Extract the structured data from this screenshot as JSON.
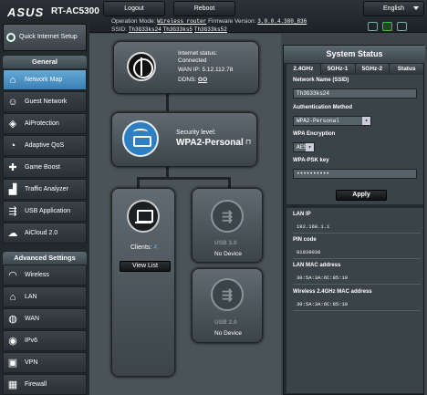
{
  "header": {
    "brand": "ASUS",
    "model": "RT-AC5300",
    "logout_label": "Logout",
    "reboot_label": "Reboot",
    "language": "English",
    "operation_mode_label": "Operation Mode:",
    "operation_mode_value": "Wireless router",
    "firmware_label": "Firmware Version:",
    "firmware_value": "3.0.0.4.380_836",
    "ssid_label": "SSID:",
    "ssids": [
      "Th3G33ks24",
      "Th3G33ks5",
      "Th3G33ks52"
    ]
  },
  "sidebar": {
    "quick_setup": "Quick Internet Setup",
    "general_heading": "General",
    "general_items": [
      {
        "label": "Network Map",
        "icon": "network-map-icon"
      },
      {
        "label": "Guest Network",
        "icon": "guest-network-icon"
      },
      {
        "label": "AiProtection",
        "icon": "shield-icon"
      },
      {
        "label": "Adaptive QoS",
        "icon": "gauge-icon"
      },
      {
        "label": "Game Boost",
        "icon": "gamepad-icon"
      },
      {
        "label": "Traffic Analyzer",
        "icon": "chart-icon"
      },
      {
        "label": "USB Application",
        "icon": "usb-icon"
      },
      {
        "label": "AiCloud 2.0",
        "icon": "cloud-icon"
      }
    ],
    "advanced_heading": "Advanced Settings",
    "advanced_items": [
      {
        "label": "Wireless",
        "icon": "wifi-icon"
      },
      {
        "label": "LAN",
        "icon": "house-icon"
      },
      {
        "label": "WAN",
        "icon": "globe-icon"
      },
      {
        "label": "IPv6",
        "icon": "ipv6-icon"
      },
      {
        "label": "VPN",
        "icon": "vpn-icon"
      },
      {
        "label": "Firewall",
        "icon": "firewall-icon"
      }
    ]
  },
  "map": {
    "internet_status_label": "Internet status:",
    "internet_status_value": "Connected",
    "wan_ip_label": "WAN IP:",
    "wan_ip_value": "5.12.112.78",
    "ddns_label": "DDNS:",
    "ddns_value": "GO",
    "security_label": "Security level:",
    "security_value": "WPA2-Personal",
    "clients_label": "Clients:",
    "clients_value": "4",
    "view_list": "View List",
    "usb1_label": "USB 3.0",
    "usb1_device": "No Device",
    "usb2_label": "USB 2.0",
    "usb2_device": "No Device"
  },
  "status": {
    "title": "System Status",
    "tabs": [
      "2.4GHz",
      "5GHz-1",
      "5GHz-2",
      "Status"
    ],
    "ssid_label": "Network Name (SSID)",
    "ssid_value": "Th3G33ks24",
    "auth_label": "Authentication Method",
    "auth_value": "WPA2-Personal",
    "enc_label": "WPA Encryption",
    "enc_value": "AES",
    "psk_label": "WPA-PSK key",
    "psk_value": "••••••••••",
    "apply_label": "Apply",
    "lan_ip_label": "LAN IP",
    "lan_ip_value": "192.168.1.1",
    "pin_label": "PIN code",
    "pin_value": "81039036",
    "lan_mac_label": "LAN MAC address",
    "lan_mac_value": "30:5A:3A:6C:85:10",
    "wl_mac_label": "Wireless 2.4GHz MAC address",
    "wl_mac_value": "30:5A:3A:6C:85:10"
  }
}
